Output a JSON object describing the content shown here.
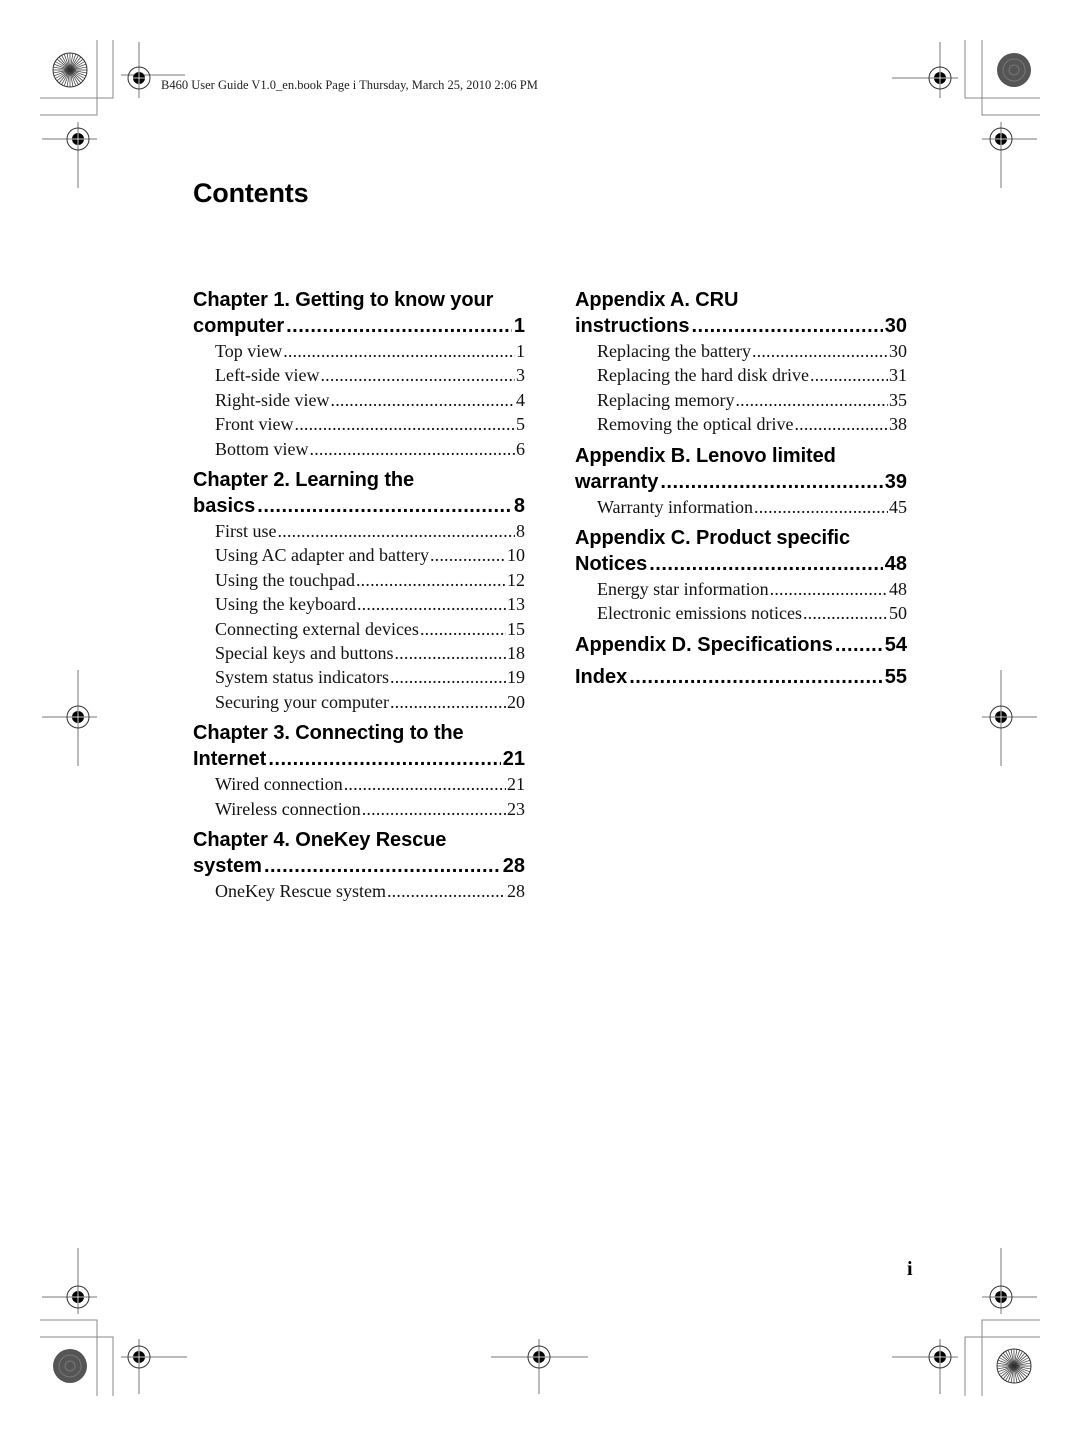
{
  "header": {
    "print_info": "B460 User Guide V1.0_en.book  Page i  Thursday, March 25, 2010  2:06 PM"
  },
  "page": {
    "title": "Contents",
    "page_number": "i"
  },
  "toc": {
    "left_column": [
      {
        "title_line1": "Chapter 1. Getting to know your",
        "title_line2": "computer",
        "page": "1",
        "items": [
          {
            "label": "Top view",
            "page": "1"
          },
          {
            "label": "Left-side view",
            "page": "3"
          },
          {
            "label": "Right-side view",
            "page": "4"
          },
          {
            "label": "Front view",
            "page": "5"
          },
          {
            "label": "Bottom view",
            "page": "6"
          }
        ]
      },
      {
        "title_line1": "Chapter 2. Learning the",
        "title_line2": "basics",
        "page": "8",
        "items": [
          {
            "label": "First use",
            "page": "8"
          },
          {
            "label": "Using AC adapter and battery",
            "page": "10"
          },
          {
            "label": "Using the touchpad",
            "page": "12"
          },
          {
            "label": "Using the keyboard",
            "page": "13"
          },
          {
            "label": "Connecting external devices",
            "page": "15"
          },
          {
            "label": "Special keys and buttons",
            "page": "18"
          },
          {
            "label": "System status indicators",
            "page": "19"
          },
          {
            "label": "Securing your computer",
            "page": "20"
          }
        ]
      },
      {
        "title_line1": "Chapter 3. Connecting to the",
        "title_line2": "Internet",
        "page": "21",
        "items": [
          {
            "label": "Wired connection",
            "page": "21"
          },
          {
            "label": "Wireless connection",
            "page": "23"
          }
        ]
      },
      {
        "title_line1": "Chapter 4. OneKey Rescue",
        "title_line2": "system",
        "page": "28",
        "items": [
          {
            "label": "OneKey Rescue system",
            "page": "28"
          }
        ]
      }
    ],
    "right_column": [
      {
        "title_line1": "Appendix A. CRU",
        "title_line2": "instructions",
        "page": "30",
        "items": [
          {
            "label": "Replacing the battery",
            "page": "30"
          },
          {
            "label": "Replacing the hard disk drive",
            "page": "31"
          },
          {
            "label": "Replacing memory",
            "page": "35"
          },
          {
            "label": "Removing the optical drive",
            "page": "38"
          }
        ]
      },
      {
        "title_line1": "Appendix B. Lenovo limited",
        "title_line2": "warranty",
        "page": "39",
        "items": [
          {
            "label": "Warranty information",
            "page": "45"
          }
        ]
      },
      {
        "title_line1": "Appendix C. Product specific",
        "title_line2": "Notices",
        "page": "48",
        "items": [
          {
            "label": "Energy star information",
            "page": "48"
          },
          {
            "label": "Electronic emissions notices",
            "page": "50"
          }
        ]
      },
      {
        "title_line1": "",
        "title_line2": "Appendix D. Specifications",
        "page": "54",
        "items": []
      },
      {
        "title_line1": "",
        "title_line2": "Index",
        "page": "55",
        "items": []
      }
    ]
  }
}
